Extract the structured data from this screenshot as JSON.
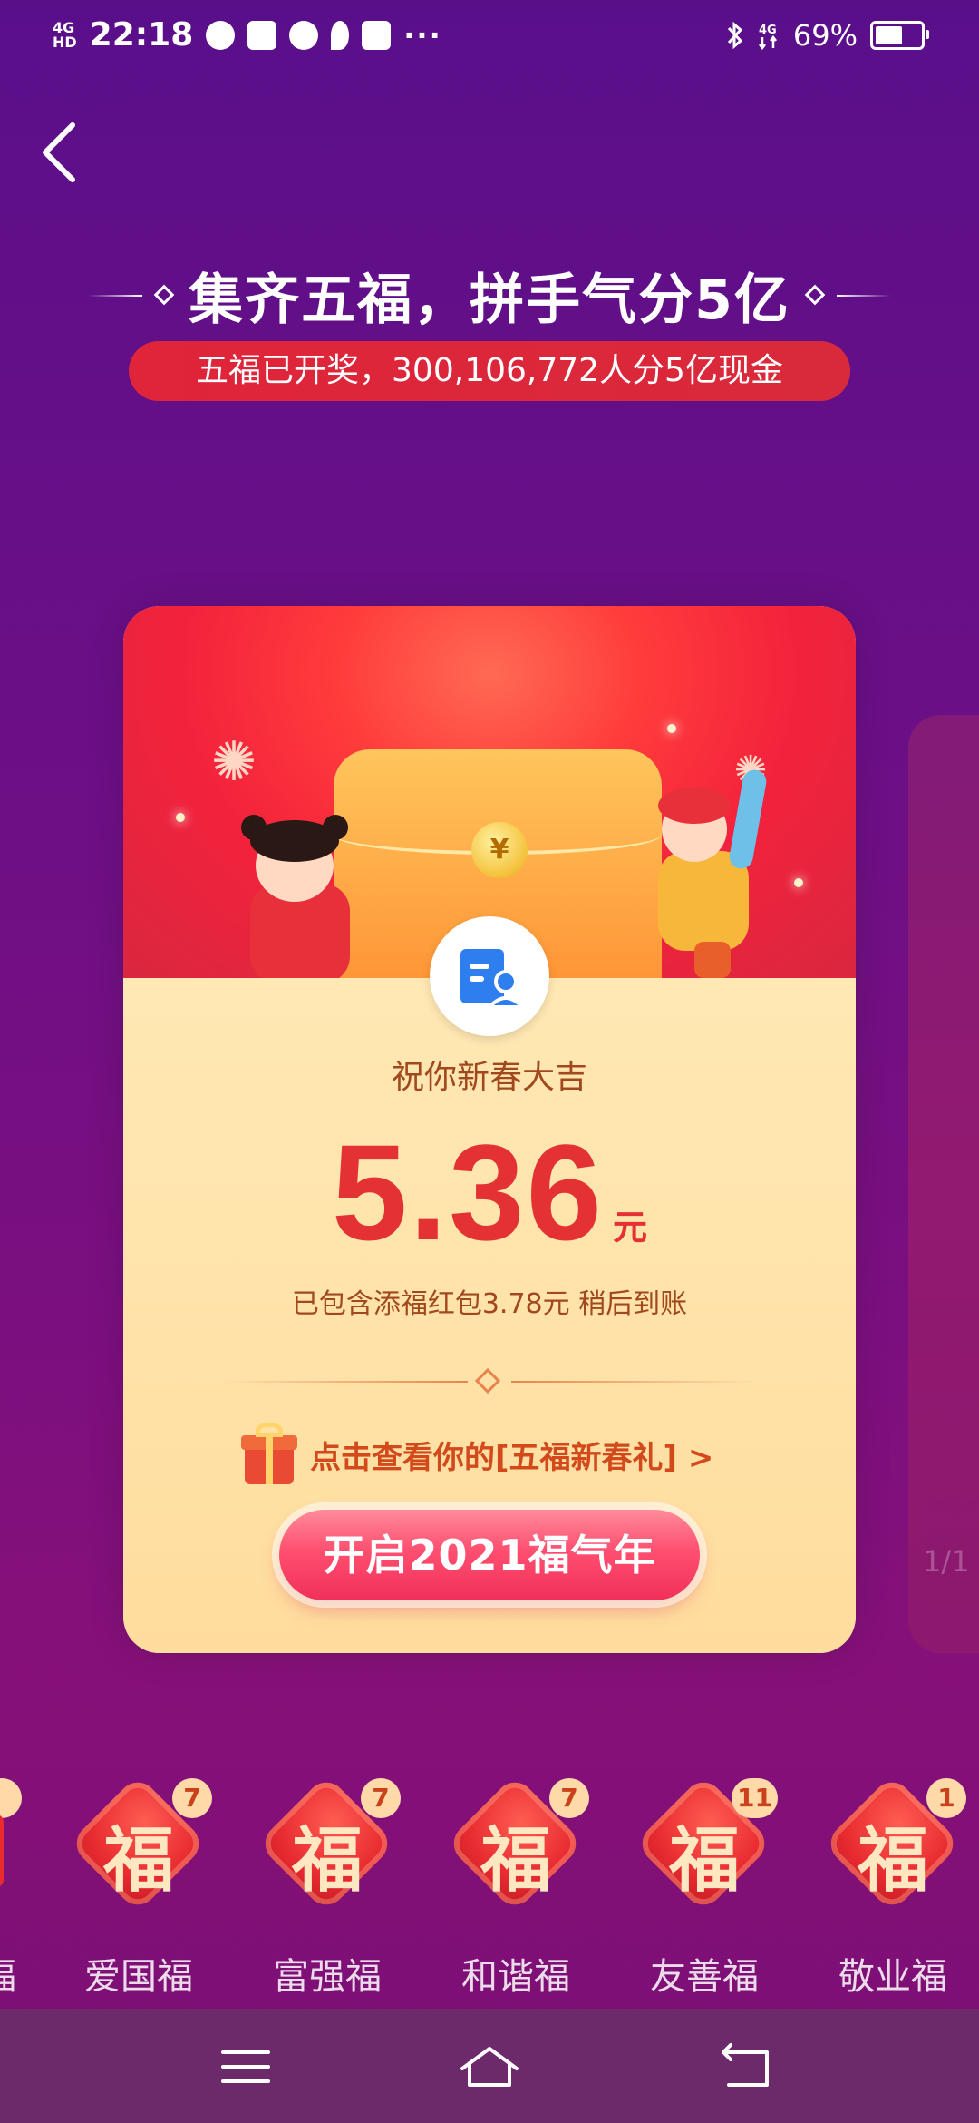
{
  "status_bar": {
    "network": "4G",
    "network_suffix": "HD",
    "time": "22:18",
    "icons": [
      "wechat-icon",
      "app-icon",
      "compass-icon",
      "location-icon",
      "photo-icon"
    ],
    "more": "···",
    "right_icons": [
      "bluetooth-icon",
      "4g-signal-icon"
    ],
    "battery_percent": "69%",
    "battery_level": 0.69
  },
  "header": {
    "title": "集齐五福，拼手气分5亿",
    "subtitle": "五福已开奖，300,106,772人分5亿现金"
  },
  "card": {
    "greeting": "祝你新春大吉",
    "amount": "5.36",
    "unit": "元",
    "note": "已包含添福红包3.78元 稍后到账",
    "gift_link": "点击查看你的[五福新春礼] >",
    "cta": "开启2021福气年",
    "coin_symbol": "¥"
  },
  "side_card": {
    "pager": "1/1"
  },
  "fu_cards": [
    {
      "char": "福",
      "count": "7",
      "label": "爱国福"
    },
    {
      "char": "福",
      "count": "7",
      "label": "富强福"
    },
    {
      "char": "福",
      "count": "7",
      "label": "和谐福"
    },
    {
      "char": "福",
      "count": "11",
      "label": "友善福"
    },
    {
      "char": "福",
      "count": "1",
      "label": "敬业福"
    }
  ],
  "fu_partial_label": "福",
  "colors": {
    "accent_red": "#e43234",
    "card_cream": "#ffe3a8",
    "bg_purple": "#6c0f86"
  }
}
